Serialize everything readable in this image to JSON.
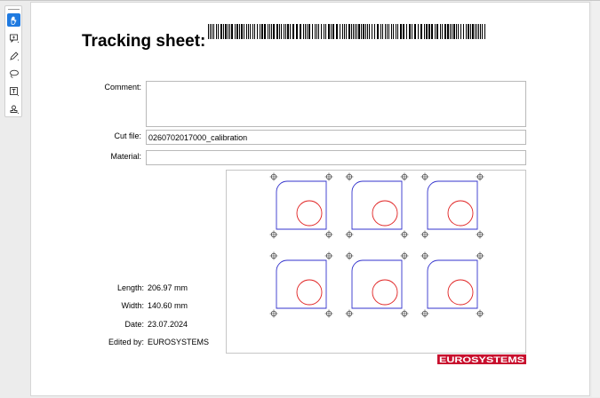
{
  "toolbar": {
    "tools": [
      {
        "name": "hand-tool",
        "active": true
      },
      {
        "name": "comment-tool",
        "active": false
      },
      {
        "name": "pen-tool",
        "active": false
      },
      {
        "name": "lasso-tool",
        "active": false
      },
      {
        "name": "text-box-tool",
        "active": false
      },
      {
        "name": "stamp-tool",
        "active": false
      }
    ]
  },
  "sheet": {
    "title": "Tracking sheet:",
    "comment_label": "Comment:",
    "cut_file_label": "Cut file:",
    "cut_file_value": "0260702017000_calibration",
    "material_label": "Material:",
    "material_value": "",
    "length_label": "Length:",
    "length_value": "206.97 mm",
    "width_label": "Width:",
    "width_value": "140.60 mm",
    "date_label": "Date:",
    "date_value": "23.07.2024",
    "edited_by_label": "Edited by:",
    "edited_by_value": "EUROSYSTEMS",
    "logo_text": "EUROSYSTEMS"
  },
  "colors": {
    "accent": "#1f7ae0",
    "part_outline": "#3333cc",
    "circle": "#e02020",
    "logo": "#c8102e"
  }
}
